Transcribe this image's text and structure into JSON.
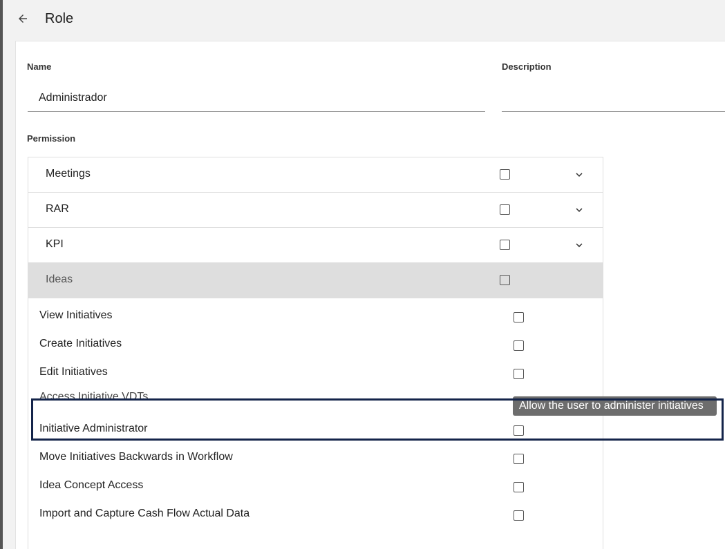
{
  "header": {
    "title": "Role"
  },
  "form": {
    "name_label": "Name",
    "name_value": "Administrador",
    "description_label": "Description",
    "description_value": "",
    "permission_label": "Permission"
  },
  "permissions": {
    "groups": [
      {
        "label": "Meetings",
        "checked": false
      },
      {
        "label": "RAR",
        "checked": false
      },
      {
        "label": "KPI",
        "checked": false
      },
      {
        "label": "Ideas",
        "checked": false
      }
    ],
    "ideas_items": [
      {
        "label": "View Initiatives",
        "checked": false
      },
      {
        "label": "Create Initiatives",
        "checked": false
      },
      {
        "label": "Edit Initiatives",
        "checked": false
      },
      {
        "label": "Access Initiative VDTs",
        "checked": false
      },
      {
        "label": "Initiative Administrator",
        "checked": false
      },
      {
        "label": "Move Initiatives Backwards in Workflow",
        "checked": false
      },
      {
        "label": "Idea Concept Access",
        "checked": false
      },
      {
        "label": "Import and Capture Cash Flow Actual Data",
        "checked": false
      }
    ]
  },
  "tooltip": {
    "text": "Allow the user to administer initiatives"
  },
  "colors": {
    "highlight_border": "#14244a",
    "tooltip_bg": "#6d6d6d",
    "active_row_bg": "#dedede"
  }
}
